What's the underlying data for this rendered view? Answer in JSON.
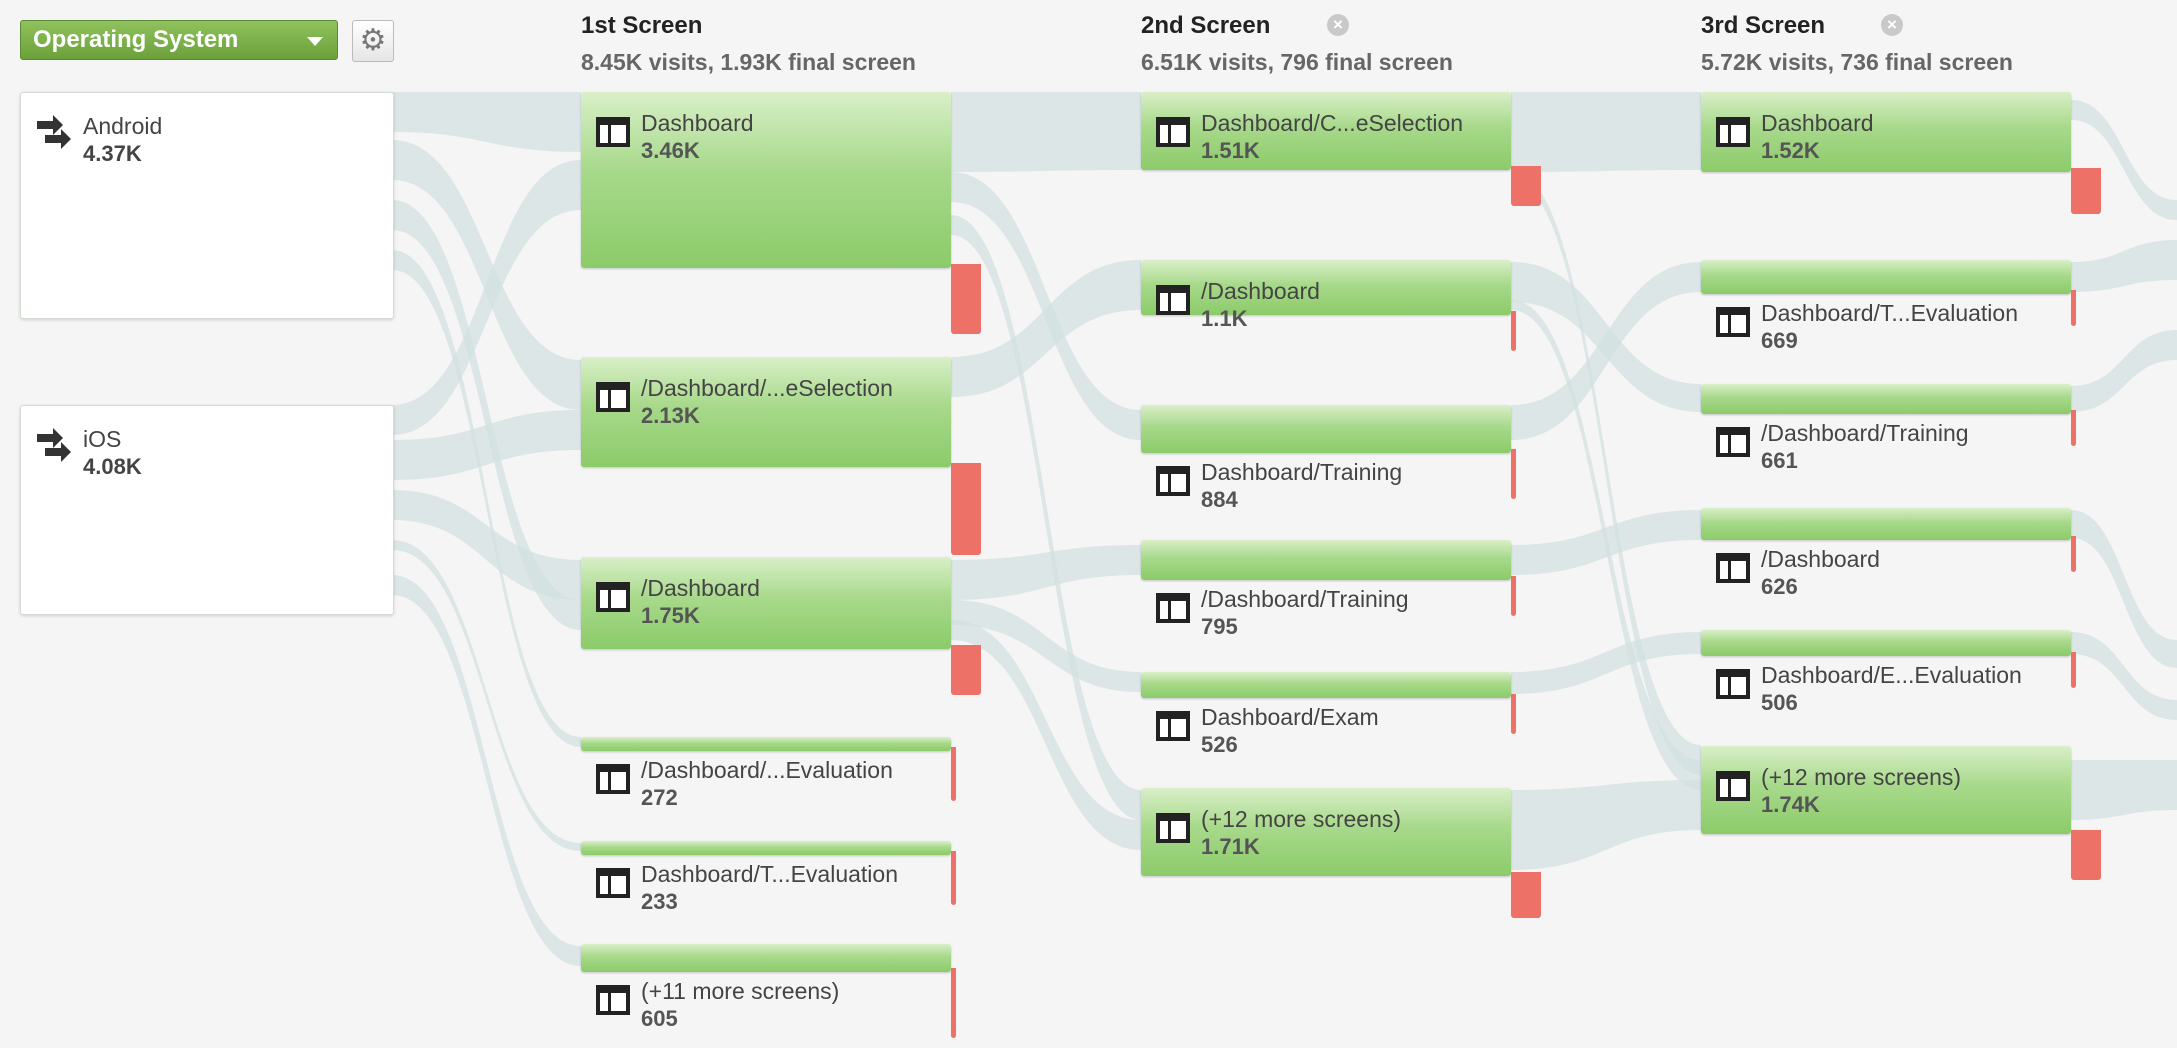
{
  "dimension_dropdown": {
    "label": "Operating System"
  },
  "columns": [
    {
      "title": "1st Screen",
      "summary": "8.45K visits, 1.93K final screen"
    },
    {
      "title": "2nd Screen",
      "summary": "6.51K visits, 796 final screen"
    },
    {
      "title": "3rd Screen",
      "summary": "5.72K visits, 736 final screen"
    }
  ],
  "sources": [
    {
      "label": "Android",
      "count": "4.37K"
    },
    {
      "label": "iOS",
      "count": "4.08K"
    }
  ],
  "screen1": [
    {
      "label": "Dashboard",
      "count": "3.46K"
    },
    {
      "label": "/Dashboard/...eSelection",
      "count": "2.13K"
    },
    {
      "label": "/Dashboard",
      "count": "1.75K"
    },
    {
      "label": "/Dashboard/...Evaluation",
      "count": "272"
    },
    {
      "label": "Dashboard/T...Evaluation",
      "count": "233"
    },
    {
      "label": "(+11 more screens)",
      "count": "605"
    }
  ],
  "screen2": [
    {
      "label": "Dashboard/C...eSelection",
      "count": "1.51K"
    },
    {
      "label": "/Dashboard",
      "count": "1.1K"
    },
    {
      "label": "Dashboard/Training",
      "count": "884"
    },
    {
      "label": "/Dashboard/Training",
      "count": "795"
    },
    {
      "label": "Dashboard/Exam",
      "count": "526"
    },
    {
      "label": "(+12 more screens)",
      "count": "1.71K"
    }
  ],
  "screen3": [
    {
      "label": "Dashboard",
      "count": "1.52K"
    },
    {
      "label": "Dashboard/T...Evaluation",
      "count": "669"
    },
    {
      "label": "/Dashboard/Training",
      "count": "661"
    },
    {
      "label": "/Dashboard",
      "count": "626"
    },
    {
      "label": "Dashboard/E...Evaluation",
      "count": "506"
    },
    {
      "label": "(+12 more screens)",
      "count": "1.74K"
    }
  ],
  "colors": {
    "node_green": "#8ccb6a",
    "exit_red": "#ee7168",
    "flow": "#d3e0e0",
    "dropdown": "#7bb04a"
  },
  "icons": {
    "source": "arrows-icon",
    "screen": "page-layout-icon",
    "settings": "gear-icon",
    "remove": "close-icon"
  }
}
